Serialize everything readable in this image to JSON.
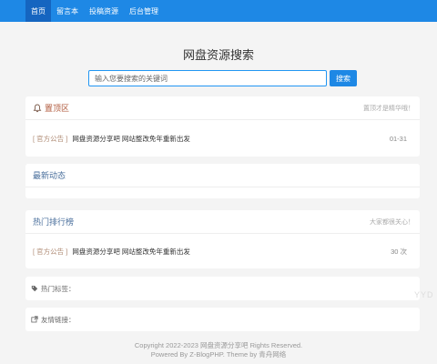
{
  "nav": {
    "items": [
      {
        "label": "首页",
        "active": true
      },
      {
        "label": "留言本",
        "active": false
      },
      {
        "label": "投稿资源",
        "active": false
      },
      {
        "label": "后台管理",
        "active": false
      }
    ]
  },
  "site_title": "网盘资源搜索",
  "search": {
    "placeholder": "输入您要搜索的关键词",
    "value": "",
    "button_label": "搜索"
  },
  "pinned": {
    "title": "置顶区",
    "note": "置顶才是精华哦！",
    "items": [
      {
        "tag": "[ 官方公告 ]",
        "title": "网盘资源分享吧 网站整改免年重新出发",
        "meta": "01-31"
      }
    ]
  },
  "latest": {
    "title": "最新动态"
  },
  "hot": {
    "title": "热门排行榜",
    "note": "大家都很关心！",
    "items": [
      {
        "tag": "[ 官方公告 ]",
        "title": "网盘资源分享吧 网站整改免年重新出发",
        "meta": "30 次"
      }
    ]
  },
  "tags_label": "热门标签：",
  "links_label": "友情链接：",
  "footer": {
    "line1": "Copyright 2022-2023 网盘资源分享吧 Rights Reserved.",
    "line2": "Powered By Z-BlogPHP. Theme by 青舟网络"
  },
  "watermark": "YYD",
  "colors": {
    "accent": "#1e88e5",
    "nav_active": "#1565c0",
    "background": "#f4f4f4",
    "tag": "#b08c76",
    "card_title": "#4a6f9c"
  },
  "icons": {
    "pinned": "bell-icon",
    "tags": "tag-icon",
    "links": "external-link-icon"
  }
}
